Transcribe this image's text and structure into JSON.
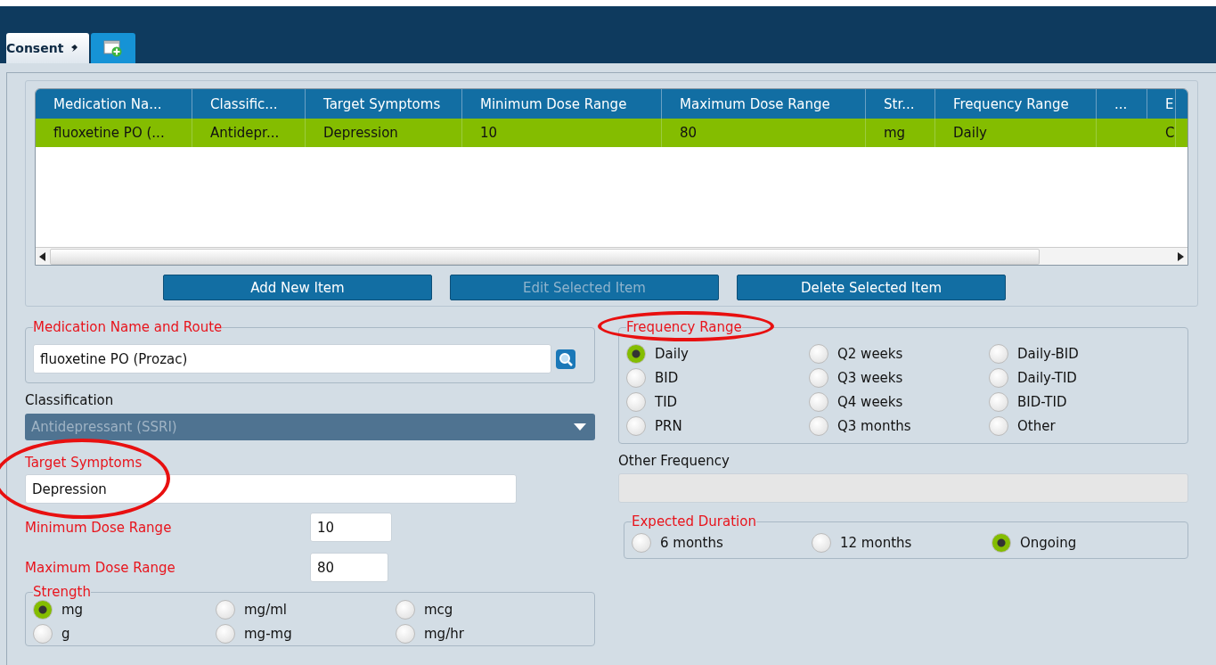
{
  "tabs": [
    {
      "kind": "text",
      "label": "Consent",
      "selected": true
    },
    {
      "kind": "add",
      "selected": false
    }
  ],
  "table": {
    "columns": [
      "Medication Na...",
      "Classific...",
      "Target Symptoms",
      "Minimum Dose Range",
      "Maximum Dose Range",
      "Str...",
      "Frequency Range",
      "...",
      "E"
    ],
    "rows": [
      {
        "selected": true,
        "cells": [
          "fluoxetine PO (...",
          "Antidepr...",
          "Depression",
          "10",
          "80",
          "mg",
          "Daily",
          "",
          "C"
        ]
      }
    ]
  },
  "buttons": [
    {
      "label": "Add New Item",
      "disabled": false
    },
    {
      "label": "Edit Selected Item",
      "disabled": true
    },
    {
      "label": "Delete Selected Item",
      "disabled": false
    }
  ],
  "medication": {
    "legend": "Medication Name and Route",
    "value": "fluoxetine PO (Prozac)"
  },
  "classification": {
    "label": "Classification",
    "value": "Antidepressant (SSRI)",
    "disabled": true
  },
  "target_symptoms": {
    "label": "Target Symptoms",
    "value": "Depression",
    "circled": true
  },
  "minimum_dose": {
    "label": "Minimum Dose Range",
    "value": "10"
  },
  "maximum_dose": {
    "label": "Maximum Dose Range",
    "value": "80"
  },
  "strength": {
    "legend": "Strength",
    "options": [
      {
        "label": "mg",
        "selected": true
      },
      {
        "label": "mg/ml",
        "selected": false
      },
      {
        "label": "mcg",
        "selected": false
      },
      {
        "label": "g",
        "selected": false
      },
      {
        "label": "mg-mg",
        "selected": false
      },
      {
        "label": "mg/hr",
        "selected": false
      }
    ]
  },
  "frequency_range": {
    "legend": "Frequency Range",
    "circled": true,
    "options": [
      {
        "label": "Daily",
        "selected": true
      },
      {
        "label": "Q2 weeks",
        "selected": false
      },
      {
        "label": "Daily-BID",
        "selected": false
      },
      {
        "label": "BID",
        "selected": false
      },
      {
        "label": "Q3 weeks",
        "selected": false
      },
      {
        "label": "Daily-TID",
        "selected": false
      },
      {
        "label": "TID",
        "selected": false
      },
      {
        "label": "Q4 weeks",
        "selected": false
      },
      {
        "label": "BID-TID",
        "selected": false
      },
      {
        "label": "PRN",
        "selected": false
      },
      {
        "label": "Q3 months",
        "selected": false
      },
      {
        "label": "Other",
        "selected": false
      }
    ]
  },
  "other_frequency": {
    "label": "Other Frequency",
    "disabled": true
  },
  "expected_duration": {
    "legend": "Expected Duration",
    "options": [
      {
        "label": "6 months",
        "selected": false
      },
      {
        "label": "12 months",
        "selected": false
      },
      {
        "label": "Ongoing",
        "selected": true
      }
    ]
  }
}
